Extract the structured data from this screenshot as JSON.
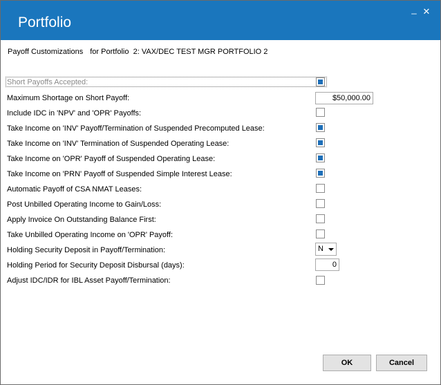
{
  "window": {
    "title": "Portfolio",
    "minimize_label": "_",
    "close_label": "✕"
  },
  "header": {
    "prefix": "Payoff Customizations",
    "for_label": "for Portfolio",
    "portfolio_name": "2: VAX/DEC TEST MGR PORTFOLIO 2"
  },
  "settings": {
    "short_payoffs": {
      "label": "Short Payoffs Accepted:",
      "checked": true,
      "disabled": true
    },
    "max_shortage": {
      "label": "Maximum Shortage on Short Payoff:",
      "value": "$50,000.00"
    },
    "include_idc": {
      "label": "Include IDC in 'NPV' and 'OPR' Payoffs:",
      "checked": false
    },
    "income_inv_precomputed": {
      "label": "Take Income on 'INV' Payoff/Termination of Suspended Precomputed Lease:",
      "checked": true
    },
    "income_inv_operating": {
      "label": "Take Income on 'INV' Termination of Suspended Operating Lease:",
      "checked": true
    },
    "income_opr_operating": {
      "label": "Take Income on 'OPR' Payoff of Suspended Operating Lease:",
      "checked": true
    },
    "income_prn_simple": {
      "label": "Take Income on 'PRN' Payoff of Suspended Simple Interest Lease:",
      "checked": true
    },
    "auto_payoff_csa": {
      "label": "Automatic Payoff of CSA NMAT Leases:",
      "checked": false
    },
    "post_unbilled": {
      "label": "Post Unbilled Operating Income to Gain/Loss:",
      "checked": false
    },
    "apply_invoice": {
      "label": "Apply Invoice On Outstanding Balance First:",
      "checked": false
    },
    "take_unbilled_opr": {
      "label": "Take Unbilled Operating Income on 'OPR' Payoff:",
      "checked": false
    },
    "holding_deposit": {
      "label": "Holding Security Deposit in Payoff/Termination:",
      "value": "N"
    },
    "holding_period": {
      "label": "Holding Period for Security Deposit Disbursal (days):",
      "value": "0"
    },
    "adjust_idc": {
      "label": "Adjust IDC/IDR for IBL Asset Payoff/Termination:",
      "checked": false
    }
  },
  "buttons": {
    "ok": "OK",
    "cancel": "Cancel"
  }
}
